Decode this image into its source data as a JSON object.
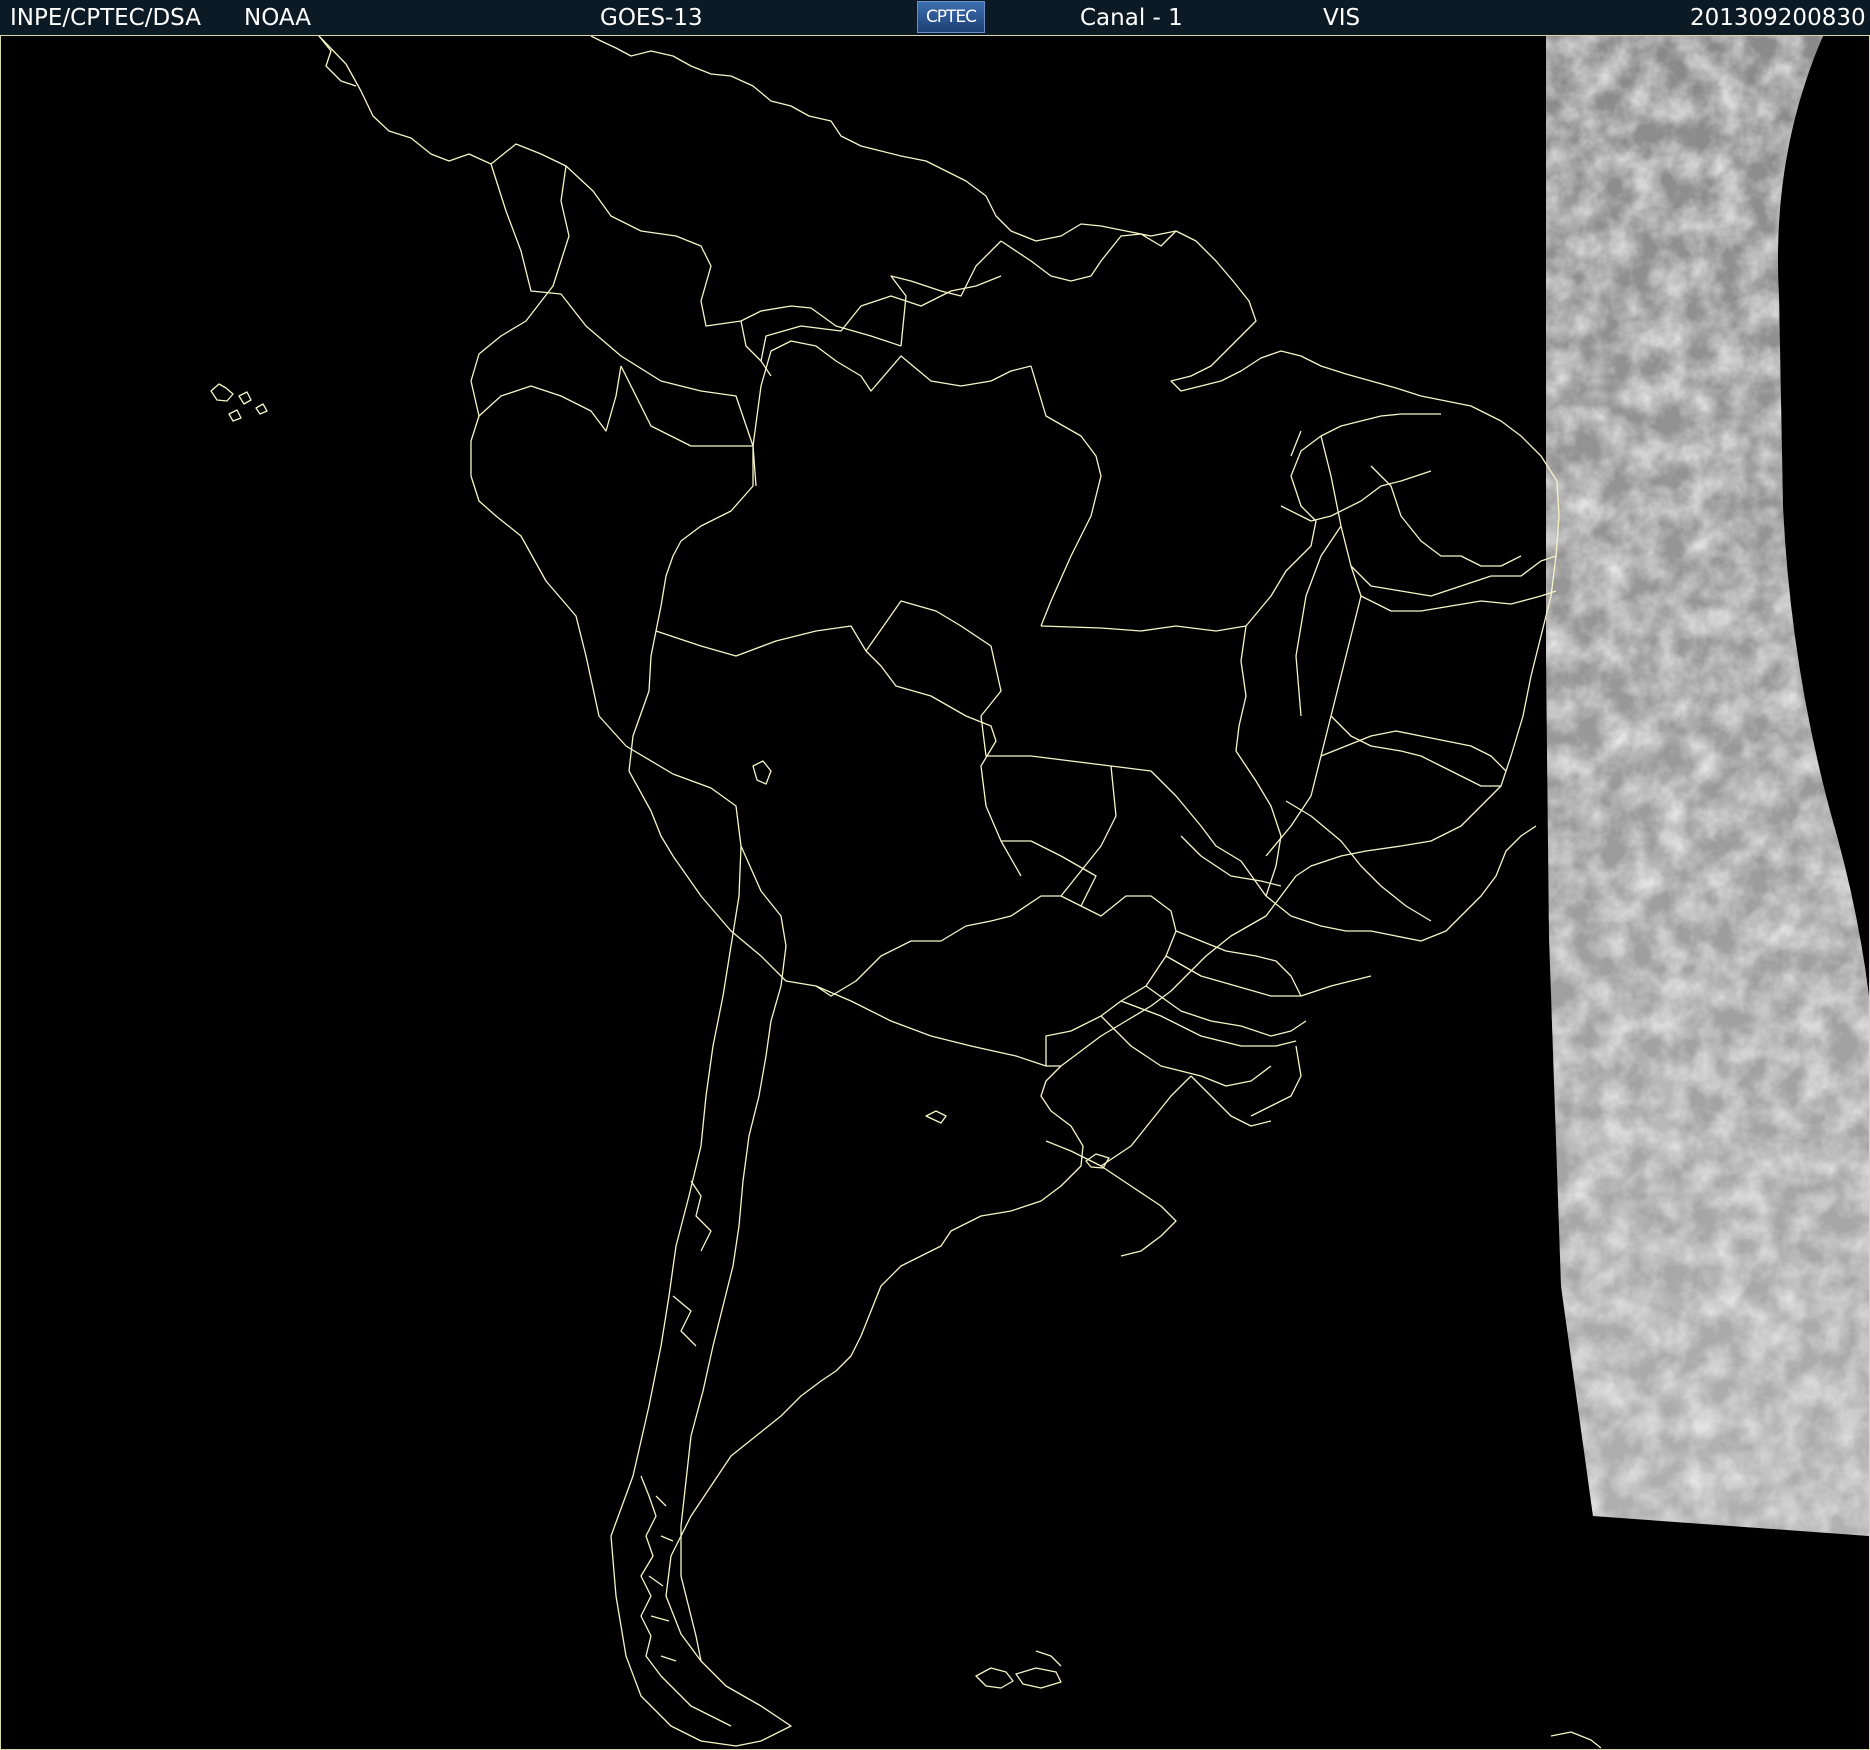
{
  "header": {
    "institution": "INPE/CPTEC/DSA",
    "agency": "NOAA",
    "satellite": "GOES-13",
    "logo_text": "CPTEC",
    "channel": "Canal - 1",
    "band": "VIS",
    "timestamp": "201309200830"
  },
  "map": {
    "background_color": "#000000",
    "border_line_color": "#f5f5c8",
    "cloud_imagery_color": "#c8c8c8"
  }
}
